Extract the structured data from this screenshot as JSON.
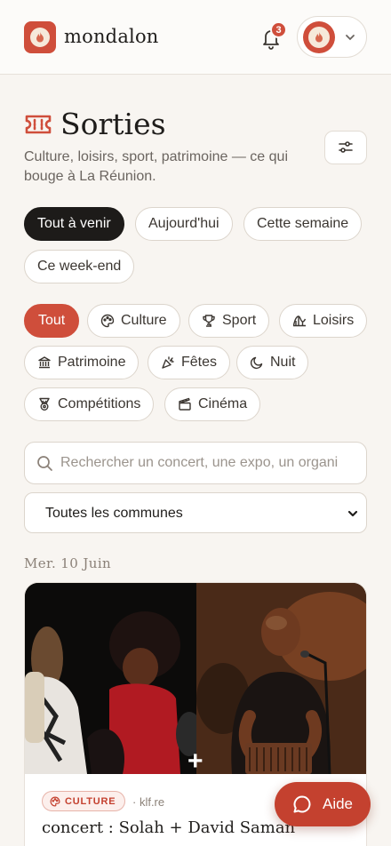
{
  "header": {
    "brand": "mondalon",
    "notifications_count": "3"
  },
  "page": {
    "title": "Sorties",
    "subtitle": "Culture, loisirs, sport, patrimoine — ce qui bouge à La Réunion."
  },
  "time_filters": [
    "Tout à venir",
    "Aujourd'hui",
    "Cette semaine",
    "Ce week-end"
  ],
  "time_filter_selected": "Tout à venir",
  "category_filters": [
    {
      "label": "Tout",
      "icon": null
    },
    {
      "label": "Culture",
      "icon": "palette-icon"
    },
    {
      "label": "Sport",
      "icon": "trophy-icon"
    },
    {
      "label": "Loisirs",
      "icon": "rollercoaster-icon"
    },
    {
      "label": "Patrimoine",
      "icon": "landmark-icon"
    },
    {
      "label": "Fêtes",
      "icon": "party-popper-icon"
    },
    {
      "label": "Nuit",
      "icon": "moon-icon"
    },
    {
      "label": "Compétitions",
      "icon": "medal-icon"
    },
    {
      "label": "Cinéma",
      "icon": "clapperboard-icon"
    }
  ],
  "category_selected": "Tout",
  "search": {
    "placeholder": "Rechercher un concert, une expo, un organi"
  },
  "commune_select": {
    "value": "Toutes les communes"
  },
  "date_group": "Mer. 10 Juin",
  "event": {
    "category": "CULTURE",
    "source": "· klf.re",
    "title": "concert : Solah + David Saman"
  },
  "help": {
    "label": "Aide"
  },
  "colors": {
    "accent": "#cf4e3b",
    "background": "#f8f5f1",
    "dark_chip": "#1d1b19"
  }
}
